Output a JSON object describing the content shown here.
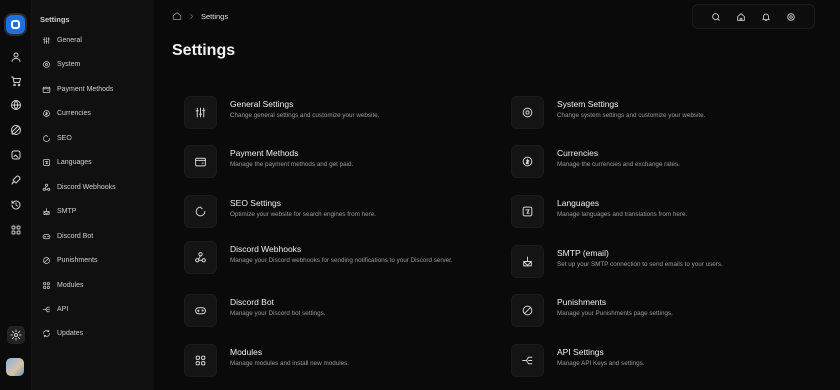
{
  "rail": {
    "icons": [
      "user-icon",
      "cart-icon",
      "globe-icon",
      "edit-icon",
      "image-icon",
      "rocket-icon",
      "history-icon",
      "grid-icon",
      "settings-icon"
    ]
  },
  "sidebar": {
    "heading": "Settings",
    "items": [
      {
        "label": "General",
        "icon": "sliders-icon"
      },
      {
        "label": "System",
        "icon": "cog-icon"
      },
      {
        "label": "Payment Methods",
        "icon": "wallet-icon"
      },
      {
        "label": "Currencies",
        "icon": "coin-icon"
      },
      {
        "label": "SEO",
        "icon": "seo-icon"
      },
      {
        "label": "Languages",
        "icon": "language-icon"
      },
      {
        "label": "Discord Webhooks",
        "icon": "webhook-icon"
      },
      {
        "label": "SMTP",
        "icon": "mail-icon"
      },
      {
        "label": "Discord Bot",
        "icon": "gamepad-icon"
      },
      {
        "label": "Punishments",
        "icon": "ban-icon"
      },
      {
        "label": "Modules",
        "icon": "modules-icon"
      },
      {
        "label": "API",
        "icon": "api-icon"
      },
      {
        "label": "Updates",
        "icon": "refresh-icon"
      }
    ]
  },
  "breadcrumb": {
    "current": "Settings"
  },
  "topbar": {
    "icons": [
      "search-icon",
      "home-icon",
      "bell-icon",
      "settings-icon"
    ]
  },
  "page": {
    "title": "Settings"
  },
  "cards": [
    {
      "title": "General Settings",
      "desc": "Change general settings and customize your website.",
      "icon": "sliders-icon"
    },
    {
      "title": "System Settings",
      "desc": "Change system settings and customize your website.",
      "icon": "cog-icon"
    },
    {
      "title": "Payment Methods",
      "desc": "Manage the payment methods and get paid.",
      "icon": "wallet-icon"
    },
    {
      "title": "Currencies",
      "desc": "Manage the currencies and exchange rates.",
      "icon": "coin-icon"
    },
    {
      "title": "SEO Settings",
      "desc": "Optimize your website for search engines from here.",
      "icon": "seo-icon"
    },
    {
      "title": "Languages",
      "desc": "Manage languages and translations from here.",
      "icon": "language-icon"
    },
    {
      "title": "Discord Webhooks",
      "desc": "Manage your Discord webhooks for sending notifications to your Discord server.",
      "icon": "webhook-icon"
    },
    {
      "title": "SMTP (email)",
      "desc": "Set up your SMTP connection to send emails to your users.",
      "icon": "mail-icon"
    },
    {
      "title": "Discord Bot",
      "desc": "Manage your Discord bot settings.",
      "icon": "gamepad-icon"
    },
    {
      "title": "Punishments",
      "desc": "Manage your Punishments page settings.",
      "icon": "ban-icon"
    },
    {
      "title": "Modules",
      "desc": "Manage modules and install new modules.",
      "icon": "modules-icon"
    },
    {
      "title": "API Settings",
      "desc": "Manage API Keys and settings.",
      "icon": "api-icon"
    }
  ]
}
